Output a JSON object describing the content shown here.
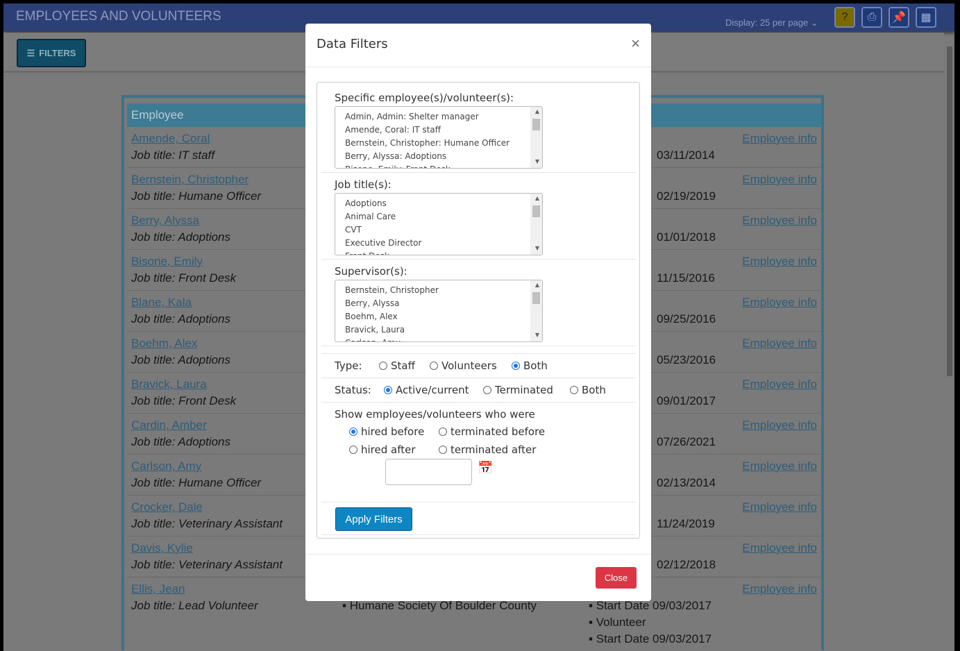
{
  "header": {
    "title": "EMPLOYEES AND VOLUNTEERS",
    "display": "Display: 25 per page ⌄",
    "icons": [
      "help-icon",
      "print-icon",
      "pin-icon",
      "layout-icon"
    ]
  },
  "filters_button": "FILTERS",
  "table": {
    "header": "Employee",
    "info_label": "Employee info",
    "rows": [
      {
        "name": "Amende, Coral",
        "job": "Job title: IT staff",
        "date": "03/11/2014"
      },
      {
        "name": "Bernstein, Christopher",
        "job": "Job title: Humane Officer",
        "date": "02/19/2019"
      },
      {
        "name": "Berry, Alyssa",
        "job": "Job title: Adoptions",
        "date": "01/01/2018"
      },
      {
        "name": "Bisone, Emily",
        "job": "Job title: Front Desk",
        "date": "11/15/2016"
      },
      {
        "name": "Blane, Kala",
        "job": "Job title: Adoptions",
        "date": "09/25/2016"
      },
      {
        "name": "Boehm, Alex",
        "job": "Job title: Adoptions",
        "date": "05/23/2016"
      },
      {
        "name": "Bravick, Laura",
        "job": "Job title: Front Desk",
        "date": "09/01/2017"
      },
      {
        "name": "Cardin, Amber",
        "job": "Job title: Adoptions",
        "date": "07/26/2021"
      },
      {
        "name": "Carlson, Amy",
        "job": "Job title: Humane Officer",
        "date": "02/13/2014"
      },
      {
        "name": "Crocker, Dale",
        "job": "Job title: Veterinary Assistant",
        "date": "11/24/2019"
      },
      {
        "name": "Davis, Kylie",
        "job": "Job title: Veterinary Assistant",
        "date": "02/12/2018"
      },
      {
        "name": "Ellis, Jean",
        "job": "Job title: Lead Volunteer",
        "date": ""
      }
    ],
    "last_org": "Humane Society Of Boulder County",
    "last_details": [
      "Start Date 09/03/2017",
      "Volunteer",
      "Start Date 09/03/2017"
    ]
  },
  "modal": {
    "title": "Data Filters",
    "close_x": "×",
    "employees_label": "Specific employee(s)/volunteer(s):",
    "employees": [
      "Admin, Admin: Shelter manager",
      "Amende, Coral: IT staff",
      "Bernstein, Christopher: Humane Officer",
      "Berry, Alyssa: Adoptions",
      "Bisone, Emily: Front Desk"
    ],
    "jobs_label": "Job title(s):",
    "jobs": [
      "Adoptions",
      "Animal Care",
      "CVT",
      "Executive Director",
      "Front Desk"
    ],
    "supervisors_label": "Supervisor(s):",
    "supervisors": [
      "Bernstein, Christopher",
      "Berry, Alyssa",
      "Boehm, Alex",
      "Bravick, Laura",
      "Carlson, Amy"
    ],
    "type_label": "Type:",
    "type_options": [
      "Staff",
      "Volunteers",
      "Both"
    ],
    "type_selected": "Both",
    "status_label": "Status:",
    "status_options": [
      "Active/current",
      "Terminated",
      "Both"
    ],
    "status_selected": "Active/current",
    "show_label": "Show employees/volunteers who were",
    "when_options": [
      "hired before",
      "terminated before",
      "hired after",
      "terminated after"
    ],
    "when_selected": "hired before",
    "date_value": "",
    "apply": "Apply Filters",
    "close": "Close"
  }
}
